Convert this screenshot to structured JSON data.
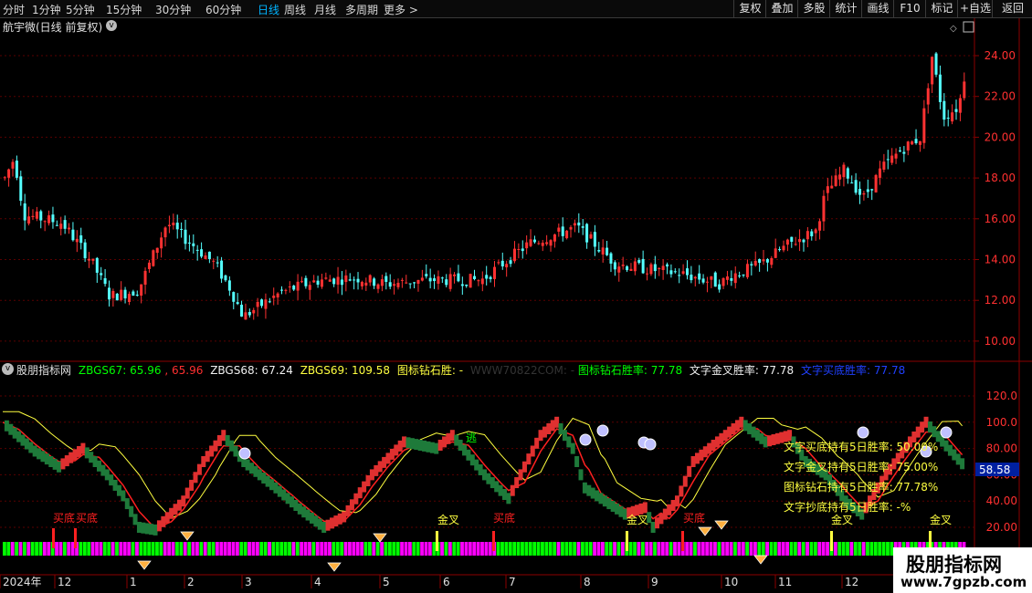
{
  "toolbar": {
    "timeframes": [
      "分时",
      "1分钟",
      "5分钟",
      "15分钟",
      "30分钟",
      "60分钟",
      "日线",
      "周线",
      "月线",
      "多周期",
      "更多 >"
    ],
    "active_index": 6,
    "right_buttons": [
      "复权",
      "叠加",
      "多股",
      "统计",
      "画线",
      "F10",
      "标记",
      "+自选",
      "返回"
    ]
  },
  "main_panel": {
    "title": "航宇微(日线 前复权)",
    "price_axis": [
      "24.00",
      "22.00",
      "20.00",
      "18.00",
      "16.00",
      "14.00",
      "12.00",
      "10.00"
    ]
  },
  "indicator_panel": {
    "icon": "circle-chevron-icon",
    "name": "股朋指标网",
    "zb67_label": "ZBGS67:",
    "zb67_value": "65.96",
    "zb67_value2": "65.96",
    "zb68_label": "ZBGS68:",
    "zb68_value": "67.24",
    "zb69_label": "ZBGS69:",
    "zb69_value": "109.58",
    "icon_win_label": "图标钻石胜:",
    "icon_win_value": "-",
    "watermark_text": "WWW70822COM:",
    "rate1_label": "图标钻石胜率:",
    "rate1_value": "77.78",
    "rate2_label": "文字金叉胜率:",
    "rate2_value": "77.78",
    "rate3_label": "文字买底胜率:",
    "rate3_value": "77.78",
    "axis": [
      "120.0",
      "100.0",
      "80.00",
      "60.00",
      "40.00",
      "20.00"
    ],
    "current_value": "58.58",
    "stats": [
      {
        "label": "文字买底持有5日胜率:",
        "value": "50.00%"
      },
      {
        "label": "文字金叉持有5日胜率:",
        "value": "75.00%"
      },
      {
        "label": "图标钻石持有5日胜率:",
        "value": "77.78%"
      },
      {
        "label": "文字抄底持有5日胜率:",
        "value": "-%"
      }
    ],
    "marker_escape": "逃",
    "signal_labels": [
      {
        "text": "买底",
        "color": "#ff2020"
      },
      {
        "text": "买底",
        "color": "#ff2020"
      },
      {
        "text": "金叉",
        "color": "#ffff40"
      },
      {
        "text": "买底",
        "color": "#ff2020"
      },
      {
        "text": "金叉",
        "color": "#ffff40"
      },
      {
        "text": "买底",
        "color": "#ff2020"
      },
      {
        "text": "金叉",
        "color": "#ffff40"
      },
      {
        "text": "金叉",
        "color": "#ffff40"
      }
    ]
  },
  "date_axis": [
    "2024年",
    "12",
    "1",
    "2",
    "3",
    "4",
    "5",
    "6",
    "7",
    "8",
    "9",
    "10",
    "11",
    "12"
  ],
  "watermark": {
    "name": "股朋指标网",
    "url": "www.7gpzb.com"
  },
  "colors": {
    "up": "#ff3232",
    "down": "#54ffff",
    "grid": "#5a0000",
    "yellow": "#ffff40",
    "green": "#00ff00",
    "magenta": "#ff00ff"
  }
}
